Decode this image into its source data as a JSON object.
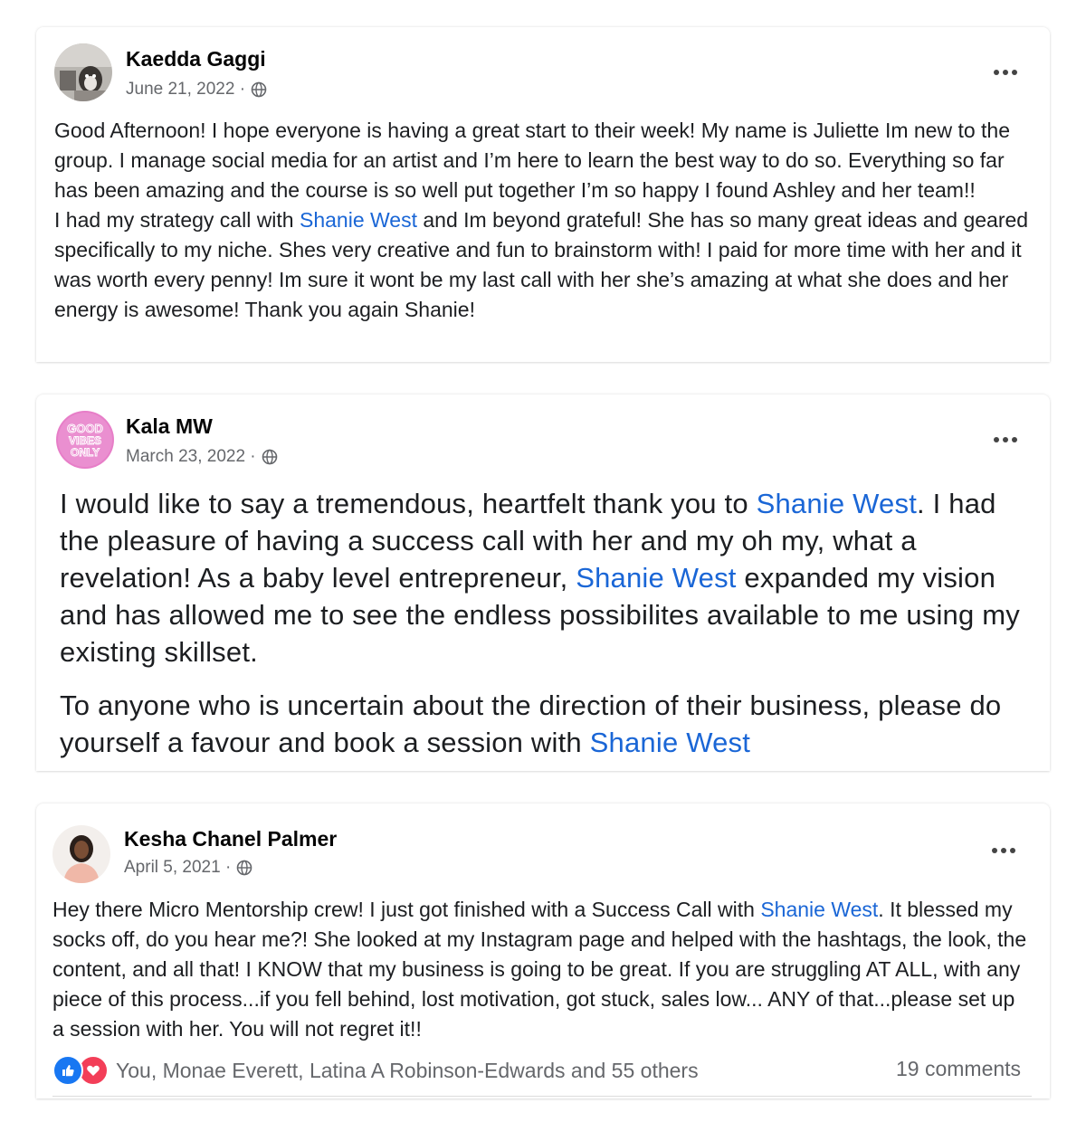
{
  "posts": [
    {
      "author": "Kaedda Gaggi",
      "date": "June 21, 2022 ·",
      "paragraphs": [
        [
          "Good Afternoon! I hope everyone is having a great start to their week! My name is Juliette Im new to the group. I manage social media for an artist and I’m here to learn the best way to do so. Everything so far has been amazing and the course is so well put together I’m so happy I found Ashley and her team!!"
        ],
        [
          "I had my strategy call with ",
          "Shanie West",
          " and Im beyond grateful! She has so many great ideas and geared specifically to my niche. Shes very creative and fun to brainstorm with! I paid for more time with her and it was worth every penny! Im sure it wont be my last call with her she’s amazing at what she does and her energy is awesome! Thank you again Shanie!"
        ]
      ]
    },
    {
      "author": "Kala MW",
      "date": "March 23, 2022 ·",
      "avatar_text": "GOOD VIBES ONLY",
      "paragraphs": [
        [
          "I would like to say a tremendous, heartfelt thank you to ",
          "Shanie West",
          ". I had the pleasure of having a success call with her and my oh my, what a revelation! As a baby level entrepreneur, ",
          "Shanie West",
          " expanded my vision and has allowed me to see the endless possibilites available to me using my existing skillset."
        ],
        [
          "To anyone who is uncertain about the direction of their business, please do yourself a favour and book a session with ",
          "Shanie West"
        ]
      ]
    },
    {
      "author": "Kesha Chanel Palmer",
      "date": "April 5, 2021 ·",
      "paragraphs": [
        [
          "Hey there Micro Mentorship crew! I just got finished with a Success Call with ",
          "Shanie West",
          ". It blessed my socks off, do you hear me?! She looked at my Instagram page and helped with the hashtags, the look, the content, and all that! I KNOW that my business is going to be great. If you are struggling AT ALL, with any piece of this process...if you fell behind, lost motivation, got stuck, sales low... ANY of that...please set up a session with her. You will not regret it!!"
        ]
      ],
      "reactions_text": "You, Monae Everett, Latina A Robinson-Edwards and 55 others",
      "comments_text": "19 comments"
    }
  ],
  "colors": {
    "link": "#1a66d6",
    "like": "#1877f2",
    "love": "#f33e58",
    "meta": "#65676b"
  },
  "icons": [
    "globe-icon",
    "more-options-icon",
    "like-reaction-icon",
    "love-reaction-icon"
  ]
}
